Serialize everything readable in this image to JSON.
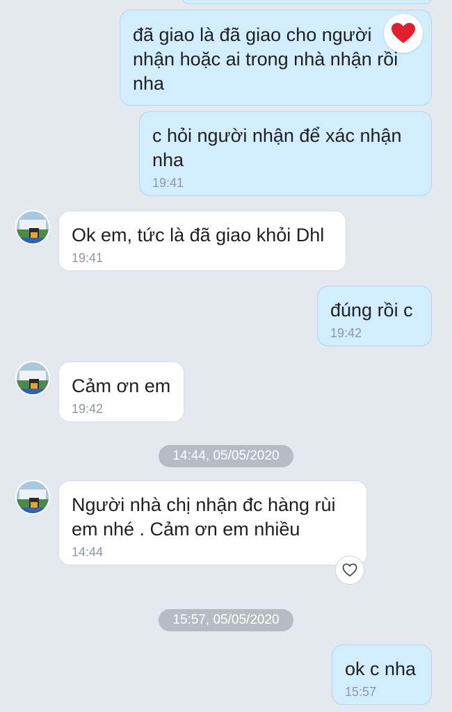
{
  "messages": [
    {
      "direction": "out",
      "text": "đã giao là đã giao cho người nhận hoặc ai trong nhà nhận rồi nha",
      "time": ""
    },
    {
      "direction": "out",
      "text": "c hỏi người nhận để xác nhận nha",
      "time": "19:41"
    },
    {
      "direction": "in",
      "text": "Ok em, tức là đã giao khỏi Dhl",
      "time": "19:41"
    },
    {
      "direction": "out",
      "text": "đúng rồi c",
      "time": "19:42"
    },
    {
      "direction": "in",
      "text": "Cảm ơn em",
      "time": "19:42"
    },
    {
      "direction": "in",
      "text": "Người nhà chị nhận đc hàng rùi em  nhé . Cảm ơn em nhiều",
      "time": "14:44"
    },
    {
      "direction": "out",
      "text": "ok c nha",
      "time": "15:57"
    }
  ],
  "date_separators": [
    "14:44, 05/05/2020",
    "15:57, 05/05/2020"
  ],
  "reactions": {
    "message0": "heart-emoji",
    "message5": "heart-outline-icon"
  },
  "colors": {
    "background": "#e4e9f0",
    "outgoing_bubble": "#d2eefe",
    "incoming_bubble": "#ffffff",
    "reaction_heart": "#e0202c"
  }
}
